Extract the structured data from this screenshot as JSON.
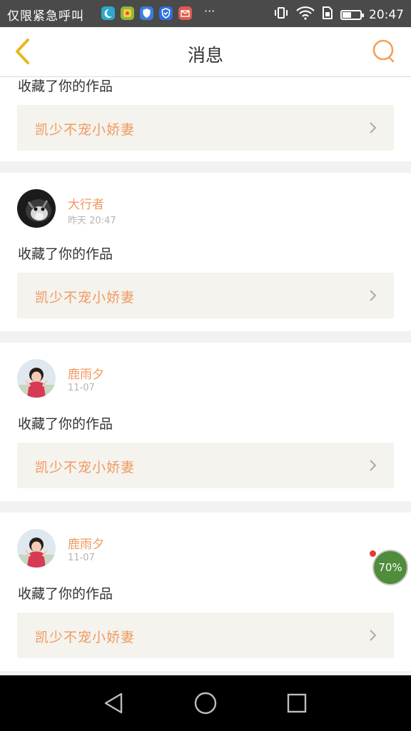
{
  "status_bar": {
    "carrier": "仅限紧急呼叫",
    "more": "···",
    "time": "20:47",
    "battery_level": 0.5
  },
  "header": {
    "back_icon": "chevron-left-icon",
    "title": "消息",
    "search_icon": "search-icon",
    "accent_color": "#f5a05a"
  },
  "messages": [
    {
      "action": "收藏了你的作品",
      "work_title": "凯少不宠小娇妻"
    },
    {
      "user": "大行者",
      "time": "昨天 20:47",
      "action": "收藏了你的作品",
      "work_title": "凯少不宠小娇妻"
    },
    {
      "user": "鹿雨夕",
      "time": "11-07",
      "action": "收藏了你的作品",
      "work_title": "凯少不宠小娇妻"
    },
    {
      "user": "鹿雨夕",
      "time": "11-07",
      "action": "收藏了你的作品",
      "work_title": "凯少不宠小娇妻"
    }
  ],
  "floating_widget": {
    "label": "70%"
  },
  "system_nav": {
    "back": "back-triangle-icon",
    "home": "home-circle-icon",
    "recents": "recents-square-icon"
  }
}
